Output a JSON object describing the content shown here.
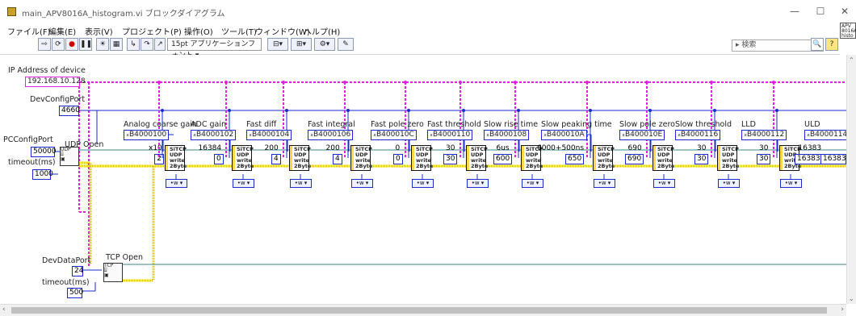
{
  "window": {
    "title": "main_APV8016A_histogram.vi ブロックダイアグラム",
    "controls": [
      "—",
      "☐",
      "✕"
    ]
  },
  "menu": [
    "ファイル(F)",
    "編集(E)",
    "表示(V)",
    "プロジェクト(P)",
    "操作(O)",
    "ツール(T)",
    "ウィンドウ(W)",
    "ヘルプ(H)"
  ],
  "toolbar": {
    "font_label": "15pt アプリケーションフォント",
    "search_placeholder": "検索",
    "context_help_icon_text": "APV 8016A histo"
  },
  "diagram": {
    "ip_label": "IP Address of device",
    "ip_value": "192.168.10.128",
    "devconfig_label": "DevConfigPort",
    "devconfig_value": "4660",
    "pcconfig_label": "PCConfigPort",
    "pcconfig_value": "50000",
    "udp_open_label": "UDP Open",
    "timeout_label": "timeout(ms)",
    "timeout_udp_value": "1000",
    "devdata_label": "DevDataPort",
    "devdata_value": "24",
    "tcp_open_label": "TCP Open",
    "timeout_tcp_value": "500",
    "first_val": "2",
    "first_val_label": "x10",
    "params": [
      {
        "name": "Analog coarse gain",
        "addr": "B4000100",
        "display": "16384",
        "value": "0"
      },
      {
        "name": "ADC gain",
        "addr": "B4000102",
        "display": "200",
        "value": "4"
      },
      {
        "name": "Fast diff",
        "addr": "B4000104",
        "display": "200",
        "value": "4"
      },
      {
        "name": "Fast integral",
        "addr": "B4000106",
        "display": "0",
        "value": "0"
      },
      {
        "name": "Fast pole zero",
        "addr": "B400010C",
        "display": "30",
        "value": "30"
      },
      {
        "name": "Fast threshold",
        "addr": "B4000110",
        "display": "6us",
        "value": "600"
      },
      {
        "name": "Slow rise time",
        "addr": "B4000108",
        "display": "6000+500ns",
        "value": "650"
      },
      {
        "name": "Slow peaking time",
        "addr": "B400010A",
        "display": "690",
        "value": "690"
      },
      {
        "name": "Slow pole zero",
        "addr": "B400010E",
        "display": "30",
        "value": "30"
      },
      {
        "name": "Slow threshold",
        "addr": "B4000116",
        "display": "30",
        "value": "30"
      },
      {
        "name": "LLD",
        "addr": "B4000112",
        "display": "16383",
        "value": "16383"
      },
      {
        "name": "ULD",
        "addr": "B4000114",
        "display": "",
        "value": ""
      }
    ],
    "subvi_text": [
      "SiTCP",
      "UDP",
      "write",
      "2Byte"
    ],
    "enum_text": "•w ▾"
  },
  "colors": {
    "ip_wire": "#e020e0",
    "int_wire": "#1a2ad0",
    "refnum_wire": "#3a8a8a",
    "error_wire": "#d4c200"
  }
}
